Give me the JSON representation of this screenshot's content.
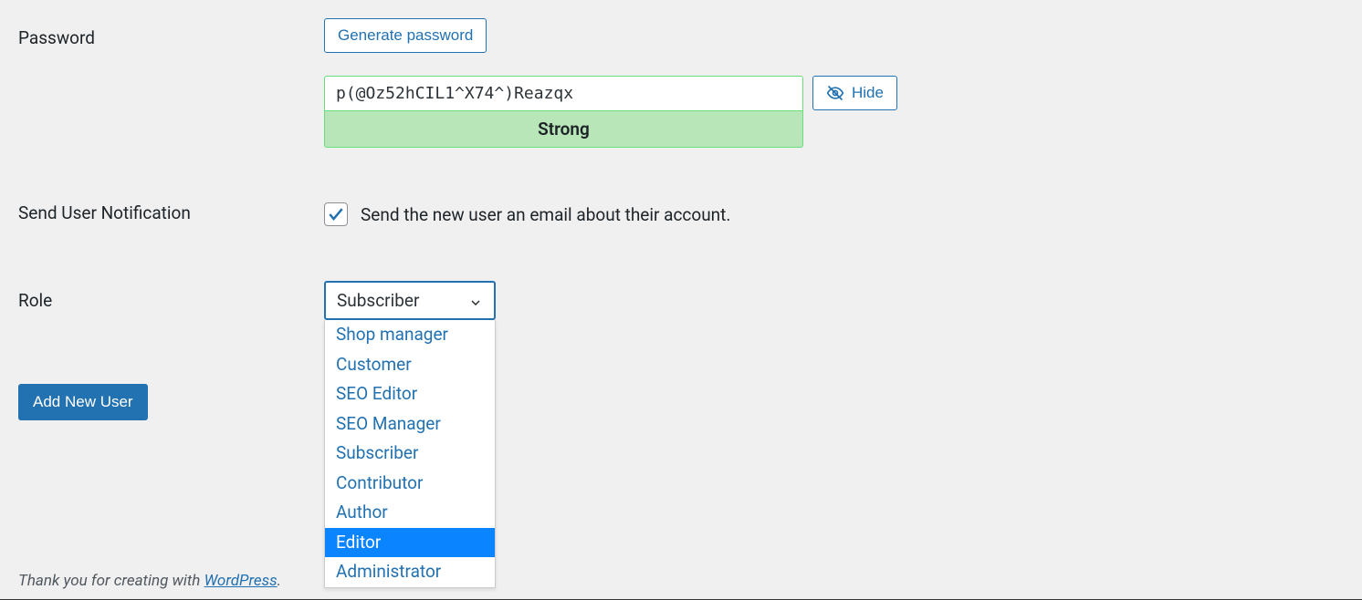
{
  "password": {
    "label": "Password",
    "generate_button": "Generate password",
    "value": "p(@Oz52hCIL1^X74^)Reazqx",
    "strength": "Strong",
    "hide_button": "Hide"
  },
  "notification": {
    "label": "Send User Notification",
    "checked": true,
    "text": "Send the new user an email about their account."
  },
  "role": {
    "label": "Role",
    "selected": "Subscriber",
    "options": [
      "Shop manager",
      "Customer",
      "SEO Editor",
      "SEO Manager",
      "Subscriber",
      "Contributor",
      "Author",
      "Editor",
      "Administrator"
    ],
    "highlighted_index": 7
  },
  "submit_button": "Add New User",
  "footer": {
    "prefix": "Thank you for creating with ",
    "link_text": "WordPress",
    "suffix": "."
  }
}
